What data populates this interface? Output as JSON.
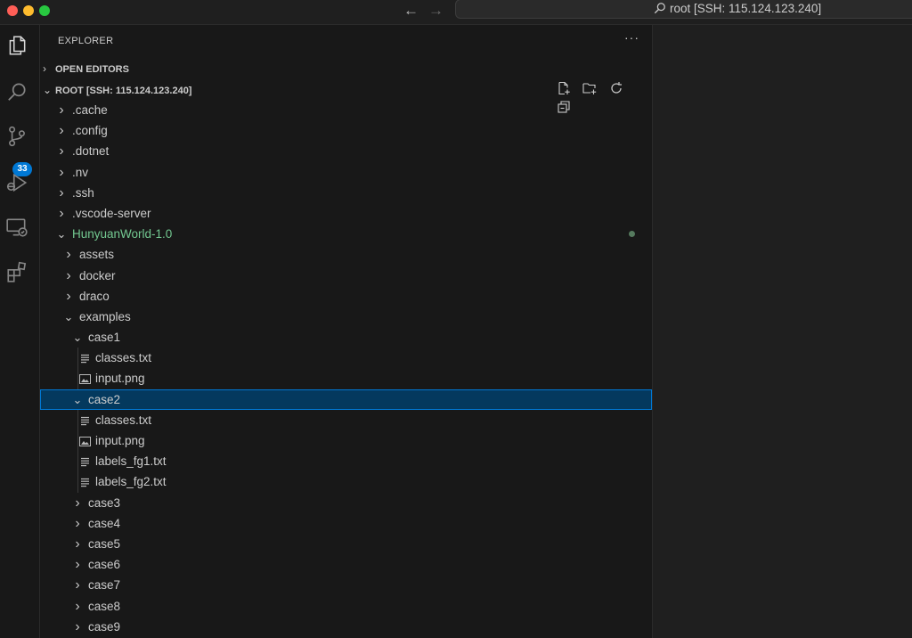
{
  "titlebar": {
    "back_icon": "arrow-left-icon",
    "forward_icon": "arrow-right-icon",
    "search_text": "root [SSH: 115.124.123.240]"
  },
  "activity": {
    "scm_badge": "33"
  },
  "explorer": {
    "title": "EXPLORER",
    "more": "···",
    "open_editors": "OPEN EDITORS",
    "root": "ROOT [SSH: 115.124.123.240]"
  },
  "tree": [
    {
      "label": ".cache",
      "kind": "folder",
      "open": false,
      "depth": 0
    },
    {
      "label": ".config",
      "kind": "folder",
      "open": false,
      "depth": 0
    },
    {
      "label": ".dotnet",
      "kind": "folder",
      "open": false,
      "depth": 0
    },
    {
      "label": ".nv",
      "kind": "folder",
      "open": false,
      "depth": 0
    },
    {
      "label": ".ssh",
      "kind": "folder",
      "open": false,
      "depth": 0
    },
    {
      "label": ".vscode-server",
      "kind": "folder",
      "open": false,
      "depth": 0
    },
    {
      "label": "HunyuanWorld-1.0",
      "kind": "folder",
      "open": true,
      "depth": 0,
      "modified": true
    },
    {
      "label": "assets",
      "kind": "folder",
      "open": false,
      "depth": 1
    },
    {
      "label": "docker",
      "kind": "folder",
      "open": false,
      "depth": 1
    },
    {
      "label": "draco",
      "kind": "folder",
      "open": false,
      "depth": 1
    },
    {
      "label": "examples",
      "kind": "folder",
      "open": true,
      "depth": 1
    },
    {
      "label": "case1",
      "kind": "folder",
      "open": true,
      "depth": 2
    },
    {
      "label": "classes.txt",
      "kind": "text",
      "depth": 3
    },
    {
      "label": "input.png",
      "kind": "image",
      "depth": 3
    },
    {
      "label": "case2",
      "kind": "folder",
      "open": true,
      "depth": 2,
      "selected": true
    },
    {
      "label": "classes.txt",
      "kind": "text",
      "depth": 3
    },
    {
      "label": "input.png",
      "kind": "image",
      "depth": 3
    },
    {
      "label": "labels_fg1.txt",
      "kind": "text",
      "depth": 3
    },
    {
      "label": "labels_fg2.txt",
      "kind": "text",
      "depth": 3
    },
    {
      "label": "case3",
      "kind": "folder",
      "open": false,
      "depth": 2
    },
    {
      "label": "case4",
      "kind": "folder",
      "open": false,
      "depth": 2
    },
    {
      "label": "case5",
      "kind": "folder",
      "open": false,
      "depth": 2
    },
    {
      "label": "case6",
      "kind": "folder",
      "open": false,
      "depth": 2
    },
    {
      "label": "case7",
      "kind": "folder",
      "open": false,
      "depth": 2
    },
    {
      "label": "case8",
      "kind": "folder",
      "open": false,
      "depth": 2
    },
    {
      "label": "case9",
      "kind": "folder",
      "open": false,
      "depth": 2
    }
  ],
  "colors": {
    "modified": "#73c991",
    "selection_bg": "#04395e",
    "selection_border": "#0078d4",
    "badge": "#0078d4"
  }
}
